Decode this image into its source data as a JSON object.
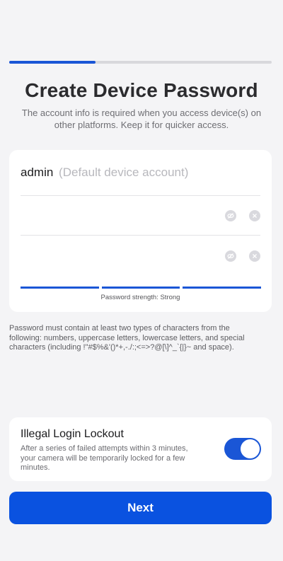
{
  "progress": {
    "fraction": 0.33,
    "accent": "#1a56d6"
  },
  "header": {
    "title": "Create Device Password",
    "subtitle": "The account info is required when you access device(s) on other platforms. Keep it for quicker access."
  },
  "form": {
    "account_value": "admin",
    "account_hint": "(Default device account)",
    "password": {
      "value": "",
      "icons": [
        "visibility-off-icon",
        "clear-icon"
      ]
    },
    "confirm_password": {
      "value": "",
      "icons": [
        "visibility-off-icon",
        "clear-icon"
      ]
    },
    "strength": {
      "level": 3,
      "max": 3,
      "label": "Password strength: Strong"
    }
  },
  "rules_text": "Password must contain at least two types of characters from the following: numbers, uppercase letters, lowercase letters, and special characters (including !\"#$%&'()*+,-./:;<=>?@[\\]^_`{|}~ and space).",
  "lockout": {
    "title": "Illegal Login Lockout",
    "description": "After a series of failed attempts within 3 minutes, your camera will be temporarily locked for a few minutes.",
    "enabled": true
  },
  "next_label": "Next",
  "colors": {
    "primary": "#0a52e0",
    "background": "#f4f4f6"
  }
}
